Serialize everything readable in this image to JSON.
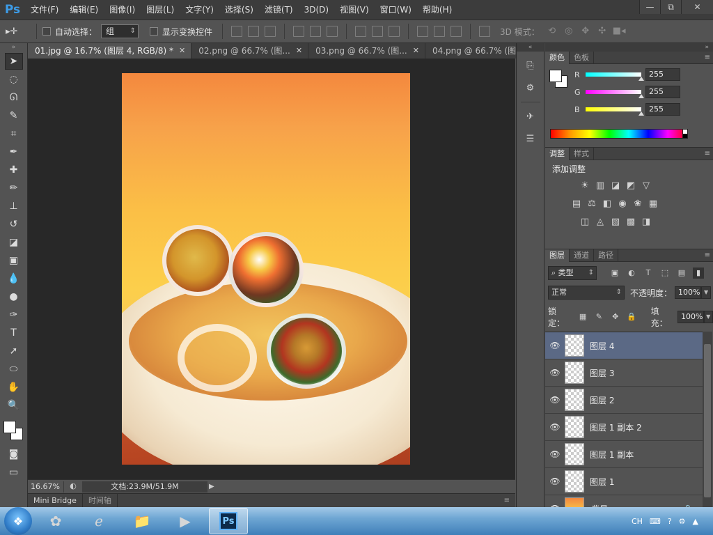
{
  "app": {
    "logo": "Ps"
  },
  "menu": [
    "文件(F)",
    "编辑(E)",
    "图像(I)",
    "图层(L)",
    "文字(Y)",
    "选择(S)",
    "滤镜(T)",
    "3D(D)",
    "视图(V)",
    "窗口(W)",
    "帮助(H)"
  ],
  "window_controls": {
    "minimize": "—",
    "restore": "⧉",
    "close": "✕"
  },
  "options": {
    "tool_glyph": "▸✛",
    "auto_select_label": "自动选择：",
    "auto_select_value": "组",
    "show_transform_label": "显示变换控件",
    "threed_mode_label": "3D 模式："
  },
  "doc_tabs": [
    {
      "label": "01.jpg @ 16.7% (图层 4, RGB/8) *",
      "active": true
    },
    {
      "label": "02.png @ 66.7% (图...",
      "active": false
    },
    {
      "label": "03.png @ 66.7% (图...",
      "active": false
    },
    {
      "label": "04.png @ 66.7% (图...",
      "active": false
    }
  ],
  "tab_close": "✕",
  "status": {
    "zoom": "16.67%",
    "doc_info": "文档:23.9M/51.9M"
  },
  "bottom_tabs": [
    "Mini Bridge",
    "时间轴"
  ],
  "color_panel": {
    "tabs": [
      "颜色",
      "色板"
    ],
    "sliders": [
      {
        "label": "R",
        "value": "255",
        "gradient": "linear-gradient(90deg,#00ffff,#ffffff)"
      },
      {
        "label": "G",
        "value": "255",
        "gradient": "linear-gradient(90deg,#ff00ff,#ffffff)"
      },
      {
        "label": "B",
        "value": "255",
        "gradient": "linear-gradient(90deg,#ffff00,#ffffff)"
      }
    ]
  },
  "adjust_panel": {
    "tabs": [
      "调整",
      "样式"
    ],
    "title": "添加调整",
    "row1": [
      "☀",
      "▥",
      "◪",
      "◩",
      "▽"
    ],
    "row2": [
      "▤",
      "⚖",
      "◧",
      "◉",
      "❀",
      "▦"
    ],
    "row3": [
      "◫",
      "◬",
      "▧",
      "▩",
      "◨"
    ]
  },
  "layers_panel": {
    "tabs": [
      "图层",
      "通道",
      "路径"
    ],
    "filter_label": "类型",
    "blend_mode": "正常",
    "opacity_label": "不透明度：",
    "opacity_value": "100%",
    "lock_label": "锁定：",
    "fill_label": "填充：",
    "fill_value": "100%",
    "layers": [
      {
        "name": "图层 4",
        "selected": true
      },
      {
        "name": "图层 3",
        "selected": false
      },
      {
        "name": "图层 2",
        "selected": false
      },
      {
        "name": "图层 1 副本 2",
        "selected": false
      },
      {
        "name": "图层 1 副本",
        "selected": false
      },
      {
        "name": "图层 1",
        "selected": false
      },
      {
        "name": "背景",
        "selected": false,
        "background": true
      }
    ]
  },
  "taskbar": {
    "tray_lang": "CH"
  }
}
